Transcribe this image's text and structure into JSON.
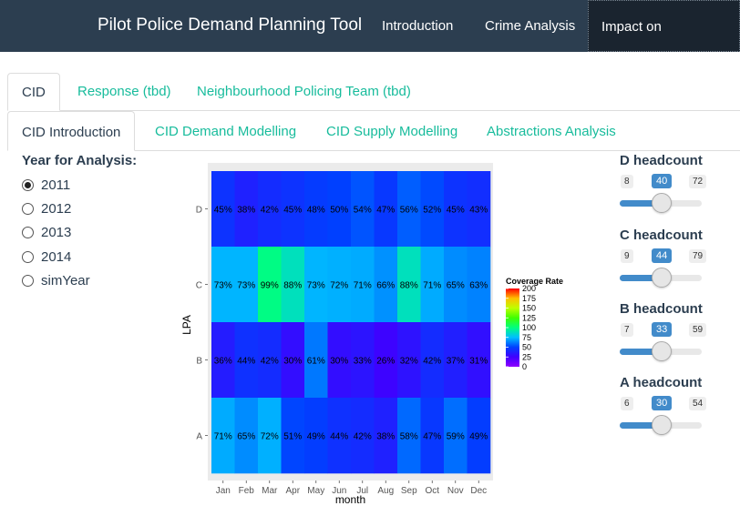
{
  "navbar": {
    "title": "Pilot Police Demand Planning Tool",
    "items": [
      {
        "label": "Introduction"
      },
      {
        "label": "Crime Analysis"
      },
      {
        "label": "Impact on Resources"
      }
    ]
  },
  "tabs_top": [
    {
      "label": "CID"
    },
    {
      "label": "Response (tbd)"
    },
    {
      "label": "Neighbourhood Policing Team (tbd)"
    }
  ],
  "tabs_sub": [
    {
      "label": "CID Introduction"
    },
    {
      "label": "CID Demand Modelling"
    },
    {
      "label": "CID Supply Modelling"
    },
    {
      "label": "Abstractions Analysis"
    }
  ],
  "year_input": {
    "label": "Year for Analysis:",
    "options": [
      "2011",
      "2012",
      "2013",
      "2014",
      "simYear"
    ],
    "selected": "2011"
  },
  "sliders": [
    {
      "label": "D headcount",
      "min": "8",
      "max": "72",
      "value": "40"
    },
    {
      "label": "C headcount",
      "min": "9",
      "max": "79",
      "value": "44"
    },
    {
      "label": "B headcount",
      "min": "7",
      "max": "59",
      "value": "33"
    },
    {
      "label": "A headcount",
      "min": "6",
      "max": "54",
      "value": "30"
    }
  ],
  "colors": {
    "navbar": "#2c3e50",
    "accent": "#18bc9c",
    "slider": "#428bca"
  },
  "chart_data": {
    "type": "heatmap",
    "xlabel": "month",
    "ylabel": "LPA",
    "x": [
      "Jan",
      "Feb",
      "Mar",
      "Apr",
      "May",
      "Jun",
      "Jul",
      "Aug",
      "Sep",
      "Oct",
      "Nov",
      "Dec"
    ],
    "y": [
      "D",
      "C",
      "B",
      "A"
    ],
    "values": [
      [
        45,
        38,
        42,
        45,
        48,
        50,
        54,
        47,
        56,
        52,
        45,
        43
      ],
      [
        73,
        73,
        99,
        88,
        73,
        72,
        71,
        66,
        88,
        71,
        65,
        63
      ],
      [
        36,
        44,
        42,
        30,
        61,
        30,
        33,
        26,
        32,
        42,
        37,
        31
      ],
      [
        71,
        65,
        72,
        51,
        49,
        44,
        42,
        38,
        58,
        47,
        59,
        49
      ]
    ],
    "legend": {
      "title": "Coverage Rate",
      "ticks": [
        200,
        175,
        150,
        125,
        100,
        75,
        50,
        25,
        0
      ]
    }
  }
}
